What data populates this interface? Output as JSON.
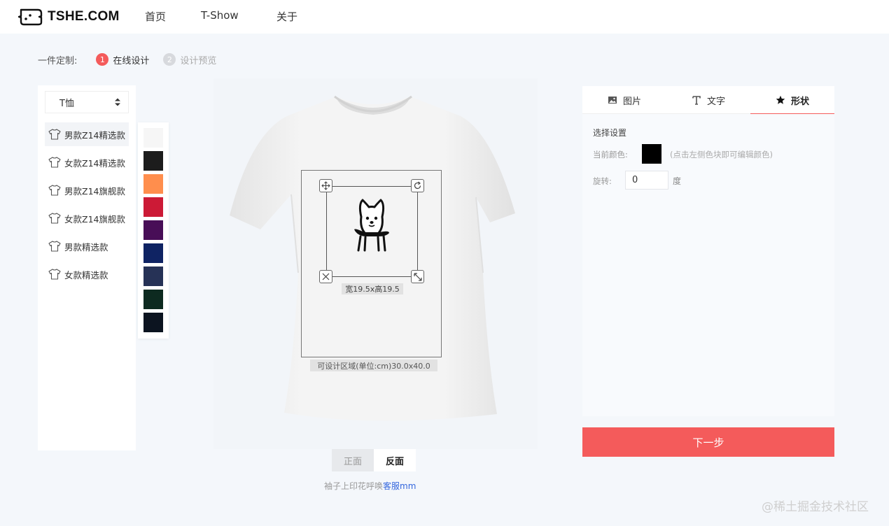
{
  "brand": {
    "name": "TSHE.COM"
  },
  "nav": {
    "items": [
      "首页",
      "T-Show",
      "关于"
    ]
  },
  "steps": {
    "label": "一件定制:",
    "items": [
      {
        "num": "1",
        "text": "在线设计",
        "state": "active"
      },
      {
        "num": "2",
        "text": "设计预览",
        "state": "inactive"
      }
    ]
  },
  "product": {
    "category": "T恤",
    "styles": [
      "男款Z14精选款",
      "女款Z14精选款",
      "男款Z14旗舰款",
      "女款Z14旗舰款",
      "男款精选款",
      "女款精选款"
    ],
    "selected_style_index": 0
  },
  "swatches": [
    "#f6f6f6",
    "#1c1c1c",
    "#ff8e4d",
    "#cc1a36",
    "#480e57",
    "#0f2363",
    "#263256",
    "#0d2a20",
    "#0c1420"
  ],
  "canvas": {
    "size_label": "宽19.5x高19.5",
    "area_label": "可设计区域(单位:cm)30.0x40.0"
  },
  "face": {
    "front": "正面",
    "back": "反面",
    "active": "back"
  },
  "sleeve_note": {
    "text": "袖子上印花呼唤",
    "link": "客服mm"
  },
  "tabs": [
    {
      "label": "图片",
      "icon": "image-icon"
    },
    {
      "label": "文字",
      "icon": "text-icon"
    },
    {
      "label": "形状",
      "icon": "star-icon"
    }
  ],
  "active_tab": "形状",
  "settings": {
    "title": "选择设置",
    "color_label": "当前颜色:",
    "color_value": "#000000",
    "color_hint": "(点击左侧色块即可编辑颜色)",
    "rotate_label": "旋转:",
    "rotate_value": "0",
    "rotate_unit": "度"
  },
  "next_button": "下一步",
  "watermark": "@稀土掘金技术社区"
}
